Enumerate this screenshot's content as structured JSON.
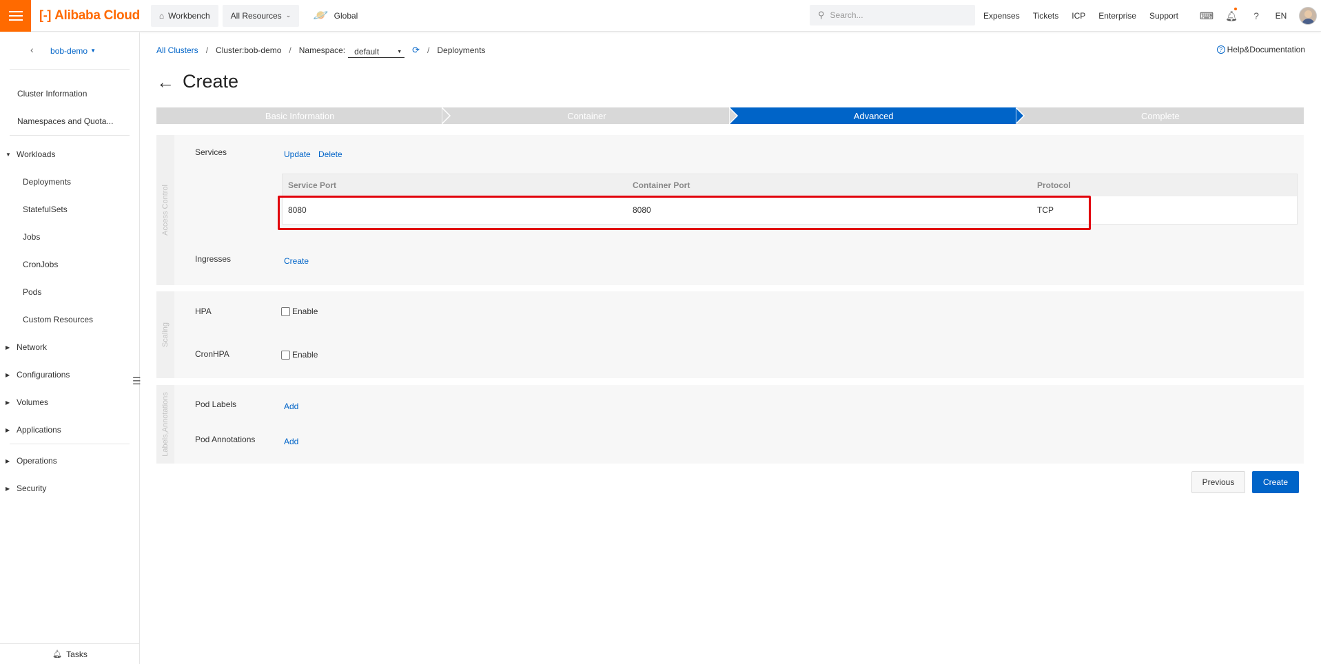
{
  "topbar": {
    "brand": "Alibaba Cloud",
    "workbench": "Workbench",
    "all_resources": "All Resources",
    "region": "Global",
    "search_placeholder": "Search...",
    "links": [
      "Expenses",
      "Tickets",
      "ICP",
      "Enterprise",
      "Support"
    ],
    "language": "EN",
    "accent_color": "#ff6a00"
  },
  "sidebar": {
    "cluster_name": "bob-demo",
    "items": [
      {
        "label": "Cluster Information",
        "type": "item"
      },
      {
        "label": "Namespaces and Quota...",
        "type": "item"
      },
      {
        "label": "Workloads",
        "type": "group-open"
      },
      {
        "label": "Deployments",
        "type": "sub"
      },
      {
        "label": "StatefulSets",
        "type": "sub"
      },
      {
        "label": "Jobs",
        "type": "sub"
      },
      {
        "label": "CronJobs",
        "type": "sub"
      },
      {
        "label": "Pods",
        "type": "sub"
      },
      {
        "label": "Custom Resources",
        "type": "sub"
      },
      {
        "label": "Network",
        "type": "group"
      },
      {
        "label": "Configurations",
        "type": "group"
      },
      {
        "label": "Volumes",
        "type": "group"
      },
      {
        "label": "Applications",
        "type": "group"
      },
      {
        "label": "Operations",
        "type": "group"
      },
      {
        "label": "Security",
        "type": "group"
      }
    ],
    "tasks": "Tasks"
  },
  "breadcrumb": {
    "all_clusters": "All Clusters",
    "cluster": "Cluster:bob-demo",
    "namespace_label": "Namespace:",
    "namespace_value": "default",
    "deployments": "Deployments",
    "help": "Help&Documentation"
  },
  "page": {
    "title": "Create",
    "steps": [
      "Basic Information",
      "Container",
      "Advanced",
      "Complete"
    ],
    "active_step": "Advanced",
    "brand_blue": "#0064c8"
  },
  "access_control": {
    "section_label": "Access Control",
    "services_label": "Services",
    "update": "Update",
    "delete": "Delete",
    "table_headers": [
      "Service Port",
      "Container Port",
      "Protocol"
    ],
    "rows": [
      {
        "service_port": "8080",
        "container_port": "8080",
        "protocol": "TCP"
      }
    ],
    "ingresses_label": "Ingresses",
    "ingress_create": "Create"
  },
  "scaling": {
    "section_label": "Scaling",
    "hpa_label": "HPA",
    "hpa_enable": "Enable",
    "cronhpa_label": "CronHPA",
    "cronhpa_enable": "Enable"
  },
  "labels": {
    "section_label": "Labels,Annotations",
    "pod_labels": "Pod Labels",
    "pod_labels_add": "Add",
    "pod_annotations": "Pod Annotations",
    "pod_annotations_add": "Add"
  },
  "footer": {
    "previous": "Previous",
    "create": "Create"
  }
}
